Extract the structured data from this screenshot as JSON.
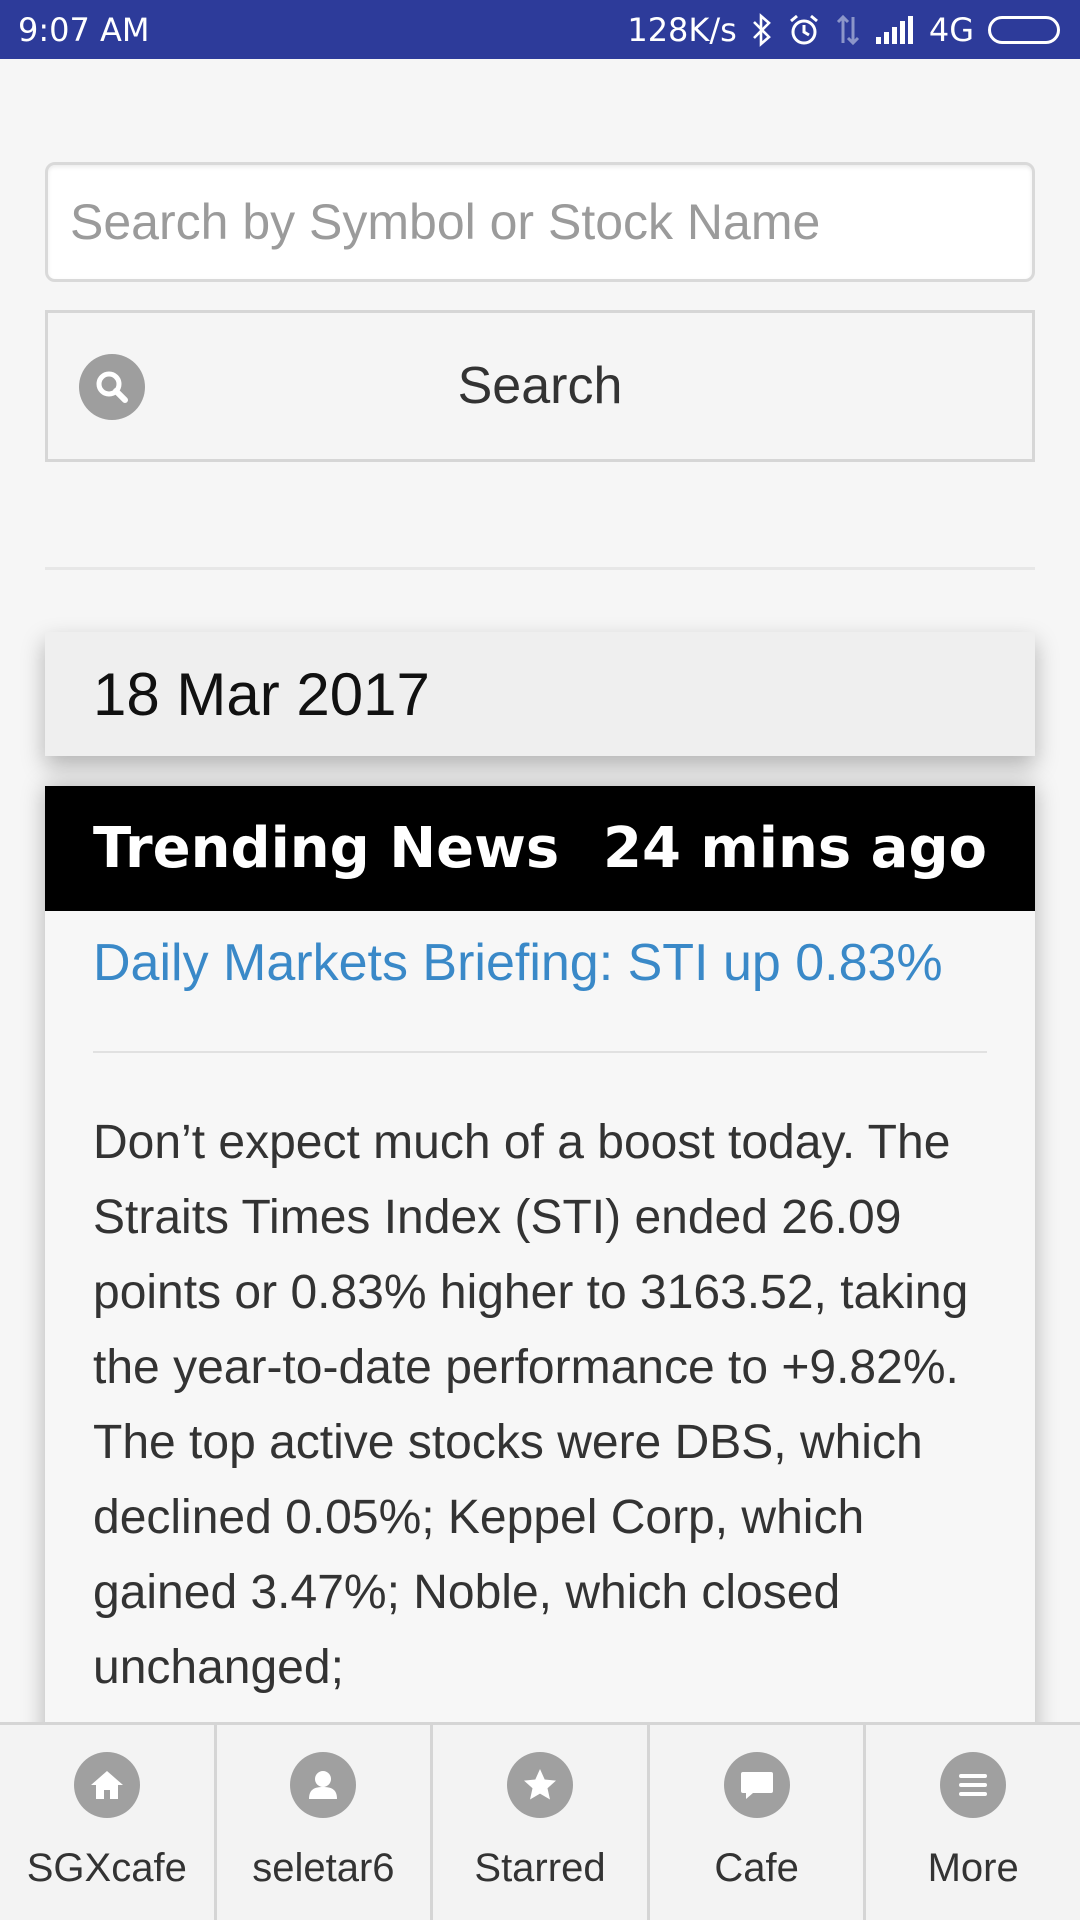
{
  "status_bar": {
    "time": "9:07 AM",
    "net_speed": "128K/s",
    "network": "4G",
    "icons": [
      "bluetooth-icon",
      "alarm-icon",
      "data-arrows-icon",
      "signal-icon",
      "battery-icon"
    ]
  },
  "search": {
    "placeholder": "Search by Symbol or Stock Name",
    "button_label": "Search",
    "icon": "search-icon"
  },
  "date_panel": {
    "date": "18 Mar 2017"
  },
  "news": {
    "section_title": "Trending News",
    "time_ago": "24 mins ago",
    "headline": "Daily Markets Briefing: STI up 0.83%",
    "body": "Don’t expect much of a boost today. The Straits Times Index (STI) ended 26.09 points or 0.83% higher to 3163.52, taking the year-to-date performance to +9.82%. The top active stocks were DBS, which declined 0.05%; Keppel Corp, which gained 3.47%; Noble, which closed unchanged;"
  },
  "bottom_nav": {
    "items": [
      {
        "label": "SGXcafe",
        "icon": "home-icon"
      },
      {
        "label": "seletar6",
        "icon": "user-icon"
      },
      {
        "label": "Starred",
        "icon": "star-icon"
      },
      {
        "label": "Cafe",
        "icon": "chat-bubble-icon"
      },
      {
        "label": "More",
        "icon": "menu-icon"
      }
    ]
  },
  "colors": {
    "status_bar": "#2d3b9a",
    "link": "#3a89c8",
    "header_bg": "#000000",
    "icon_grey": "#a0a0a0"
  }
}
